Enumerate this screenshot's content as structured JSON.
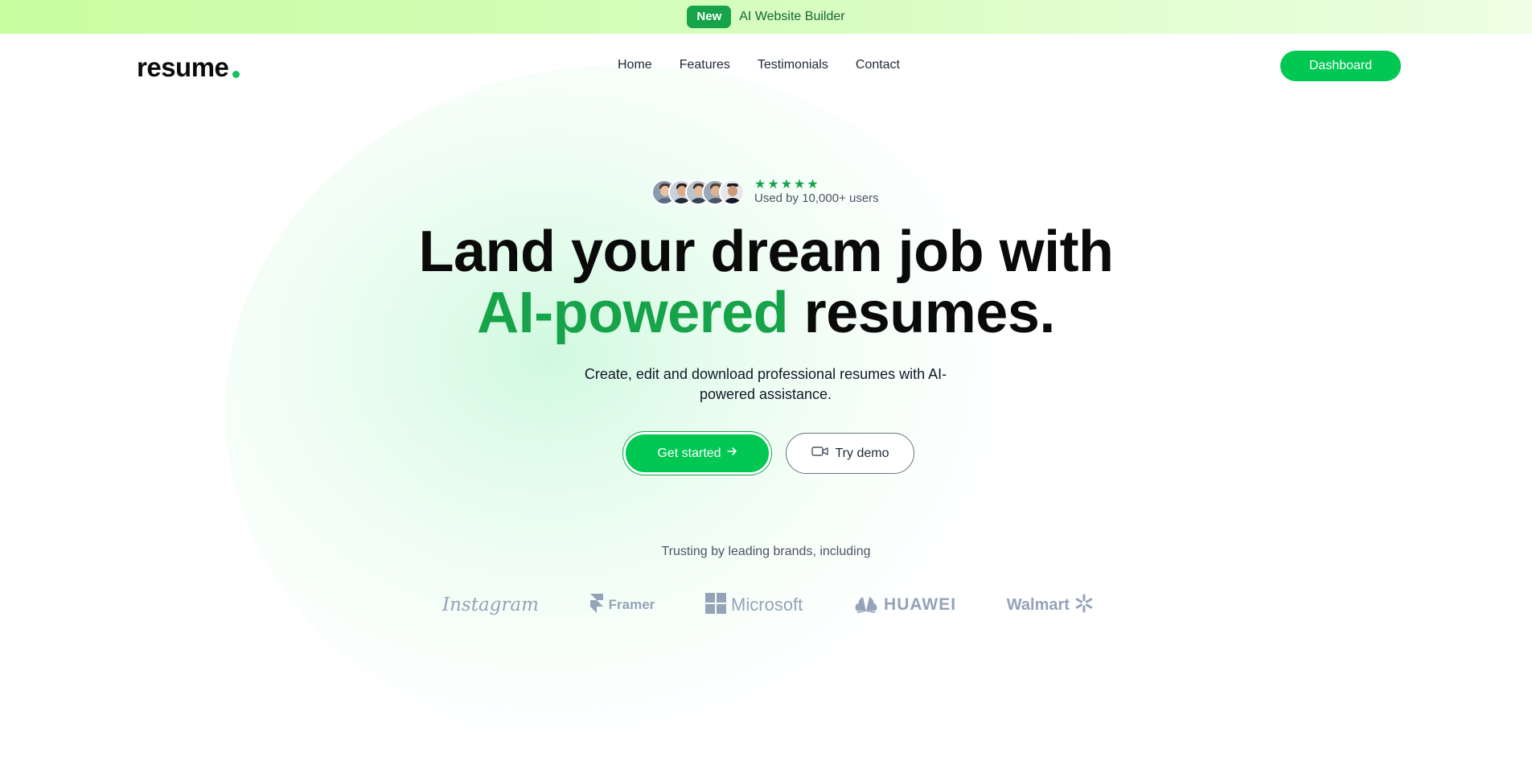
{
  "announcement": {
    "badge": "New",
    "text": "AI Website Builder"
  },
  "nav": {
    "logo": "resume",
    "links": [
      "Home",
      "Features",
      "Testimonials",
      "Contact"
    ],
    "cta": "Dashboard"
  },
  "social_proof": {
    "rating": 5,
    "text": "Used by 10,000+ users"
  },
  "hero": {
    "title_line1": "Land your dream job with",
    "title_accent": "AI-powered",
    "title_rest": "resumes.",
    "subtitle": "Create, edit and download professional resumes with AI-powered assistance.",
    "primary_cta": "Get started",
    "secondary_cta": "Try demo"
  },
  "brands": {
    "label": "Trusting by leading brands, including",
    "items": [
      "Instagram",
      "Framer",
      "Microsoft",
      "HUAWEI",
      "Walmart"
    ]
  },
  "colors": {
    "accent": "#16a34a",
    "button": "#00c853",
    "brand_gray": "#94a3b8"
  }
}
